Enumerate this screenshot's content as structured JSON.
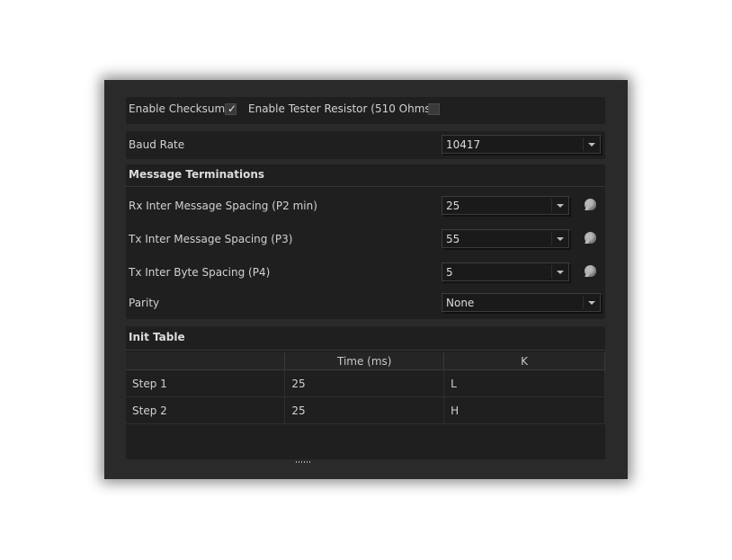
{
  "checksum": {
    "label": "Enable Checksum",
    "checked": true
  },
  "tester_resistor": {
    "label": "Enable Tester Resistor (510 Ohms)",
    "checked": false
  },
  "baud_rate": {
    "label": "Baud Rate",
    "value": "10417"
  },
  "message_terminations": {
    "title": "Message Terminations",
    "rx_spacing": {
      "label": "Rx Inter Message Spacing (P2 min)",
      "value": "25"
    },
    "tx_spacing": {
      "label": "Tx Inter Message Spacing (P3)",
      "value": "55"
    },
    "tx_byte_spacing": {
      "label": "Tx Inter Byte Spacing (P4)",
      "value": "5"
    },
    "parity": {
      "label": "Parity",
      "value": "None"
    }
  },
  "init_table": {
    "title": "Init Table",
    "columns": [
      "",
      "Time (ms)",
      "K"
    ],
    "rows": [
      {
        "step": "Step 1",
        "time": "25",
        "k": "L"
      },
      {
        "step": "Step 2",
        "time": "25",
        "k": "H"
      }
    ]
  }
}
